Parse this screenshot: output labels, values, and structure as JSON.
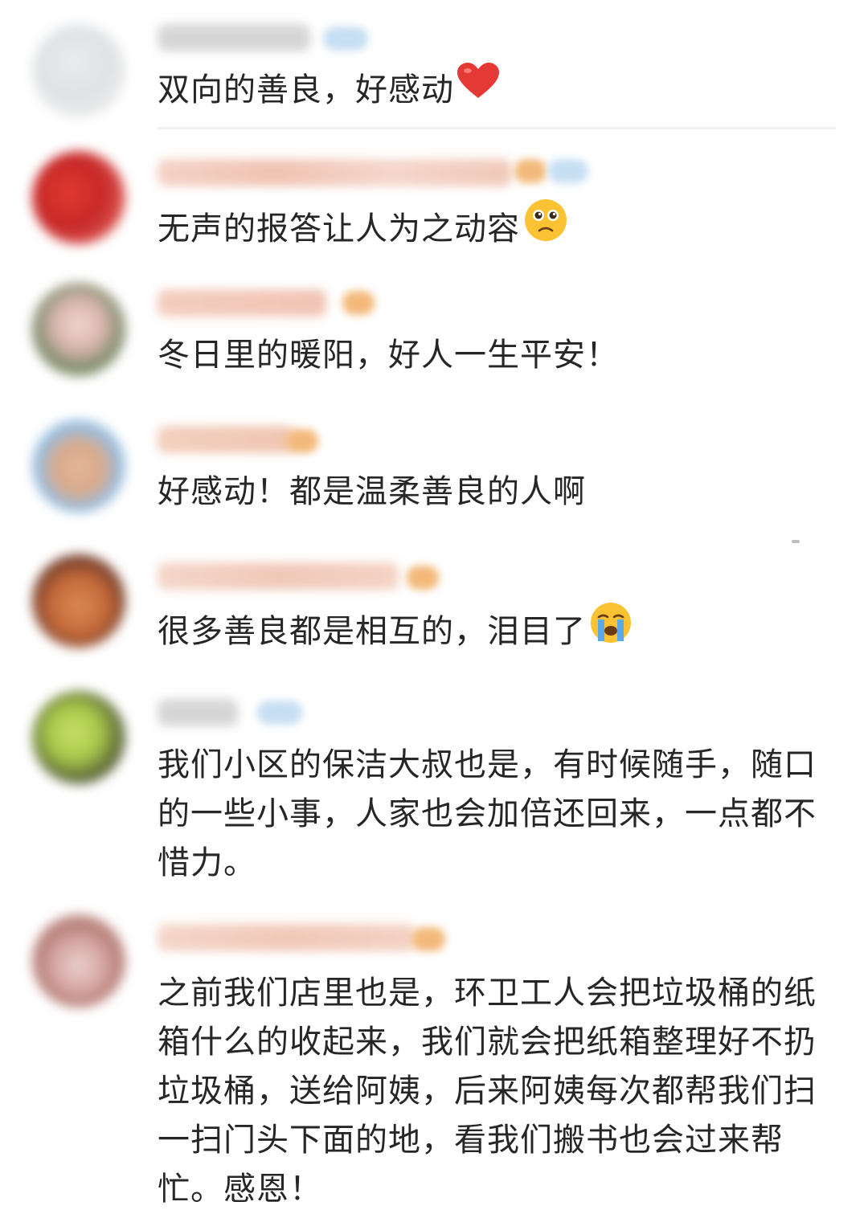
{
  "comments": [
    {
      "text": "双向的善良，好感动",
      "emoji": "heart-icon"
    },
    {
      "text": "无声的报答让人为之动容",
      "emoji": "pleading-face-icon"
    },
    {
      "text": "冬日里的暖阳，好人一生平安！",
      "emoji": null
    },
    {
      "text": "好感动！都是温柔善良的人啊",
      "emoji": null
    },
    {
      "text": "很多善良都是相互的，泪目了",
      "emoji": "crying-face-icon"
    },
    {
      "text": "我们小区的保洁大叔也是，有时候随手，随口的一些小事，人家也会加倍还回来，一点都不惜力。",
      "emoji": null
    },
    {
      "text": "之前我们店里也是，环卫工人会把垃圾桶的纸箱什么的收起来，我们就会把纸箱整理好不扔垃圾桶，送给阿姨，后来阿姨每次都帮我们扫一扫门头下面的地，看我们搬书也会过来帮忙。感恩！",
      "emoji": null
    }
  ],
  "colors": {
    "text": "#262626",
    "divider": "#f0f0f0",
    "badge_blue": "#b9d9f5",
    "badge_orange": "#f6b36a",
    "heart": "#e53935",
    "emoji_yellow": "#fbc233"
  }
}
